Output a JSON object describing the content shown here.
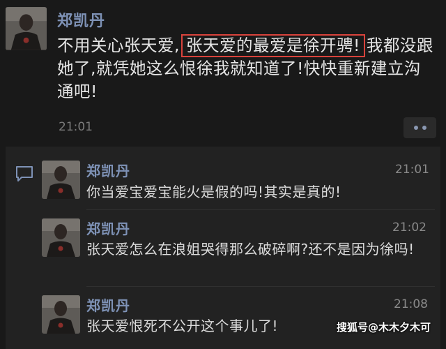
{
  "post": {
    "author": "郑凯丹",
    "text_before": "不用关心张天爱,",
    "text_highlight": "张天爱的最爱是徐开骋!",
    "text_after": "我都没跟她了,就凭她这么恨徐我就知道了!快快重新建立沟通吧!",
    "time": "21:01",
    "highlight_color": "#d9433c"
  },
  "comments": [
    {
      "author": "郑凯丹",
      "time": "21:01",
      "text": "你当爱宝爱宝能火是假的吗!其实是真的!"
    },
    {
      "author": "郑凯丹",
      "time": "21:02",
      "text": "张天爱怎么在浪姐哭得那么破碎啊?还不是因为徐吗!"
    },
    {
      "author": "郑凯丹",
      "time": "21:08",
      "text": "张天爱恨死不公开这个事儿了!"
    }
  ],
  "watermark": "搜狐号@木木夕木可",
  "icons": {
    "post_avatar": "avatar-photo",
    "more": "more-dots-icon",
    "comments": "comment-bubble-icon"
  },
  "colors": {
    "background": "#191919",
    "name": "#7e92b6",
    "panel": "#222222"
  }
}
